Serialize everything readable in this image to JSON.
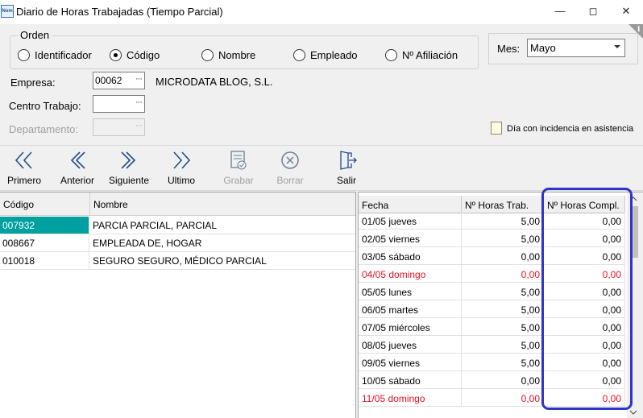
{
  "window": {
    "title": "Diario de Horas Trabajadas (Tiempo Parcial)",
    "app_icon_text": "Nom",
    "minimize_label": "—",
    "maximize_label": "◻",
    "close_label": "✕"
  },
  "orden": {
    "title": "Orden",
    "options": [
      "Identificador",
      "Código",
      "Nombre",
      "Empleado",
      "Nº Afiliación"
    ],
    "selected": "Código"
  },
  "mes": {
    "label": "Mes:",
    "value": "Mayo"
  },
  "empresa": {
    "label": "Empresa:",
    "value": "00062",
    "name": "MICRODATA BLOG, S.L."
  },
  "centro": {
    "label": "Centro Trabajo:",
    "value": ""
  },
  "departamento": {
    "label": "Departamento:",
    "value": ""
  },
  "legend": {
    "text": "Día con incidencia en asistencia",
    "color": "#fffbe0"
  },
  "toolbar": {
    "primero": "Primero",
    "anterior": "Anterior",
    "siguiente": "Siguiente",
    "ultimo": "Ultimo",
    "grabar": "Grabar",
    "borrar": "Borrar",
    "salir": "Salir"
  },
  "employees": {
    "headers": {
      "codigo": "Código",
      "nombre": "Nombre"
    },
    "rows": [
      {
        "codigo": "007932",
        "nombre": "PARCIA PARCIAL, PARCIAL",
        "selected": true
      },
      {
        "codigo": "008667",
        "nombre": "EMPLEADA DE, HOGAR",
        "selected": false
      },
      {
        "codigo": "010018",
        "nombre": "SEGURO SEGURO, MÉDICO PARCIAL",
        "selected": false
      }
    ]
  },
  "hours": {
    "headers": {
      "fecha": "Fecha",
      "trab": "Nº Horas Trab.",
      "compl": "Nº Horas Compl."
    },
    "rows": [
      {
        "fecha": "01/05 jueves",
        "trab": "5,00",
        "compl": "0,00",
        "holiday": false
      },
      {
        "fecha": "02/05 viernes",
        "trab": "5,00",
        "compl": "0,00",
        "holiday": false
      },
      {
        "fecha": "03/05 sábado",
        "trab": "0,00",
        "compl": "0,00",
        "holiday": false
      },
      {
        "fecha": "04/05 domingo",
        "trab": "0,00",
        "compl": "0,00",
        "holiday": true
      },
      {
        "fecha": "05/05 lunes",
        "trab": "5,00",
        "compl": "0,00",
        "holiday": false
      },
      {
        "fecha": "06/05 martes",
        "trab": "5,00",
        "compl": "0,00",
        "holiday": false
      },
      {
        "fecha": "07/05 miércoles",
        "trab": "5,00",
        "compl": "0,00",
        "holiday": false
      },
      {
        "fecha": "08/05 jueves",
        "trab": "5,00",
        "compl": "0,00",
        "holiday": false
      },
      {
        "fecha": "09/05 viernes",
        "trab": "5,00",
        "compl": "0,00",
        "holiday": false
      },
      {
        "fecha": "10/05 sábado",
        "trab": "0,00",
        "compl": "0,00",
        "holiday": false
      },
      {
        "fecha": "11/05 domingo",
        "trab": "0,00",
        "compl": "0,00",
        "holiday": true
      }
    ]
  },
  "colors": {
    "selected_row": "#00a0a0",
    "holiday_text": "#e81123",
    "highlight": "#2e35c9",
    "accent_icon": "#1f4e8c"
  }
}
